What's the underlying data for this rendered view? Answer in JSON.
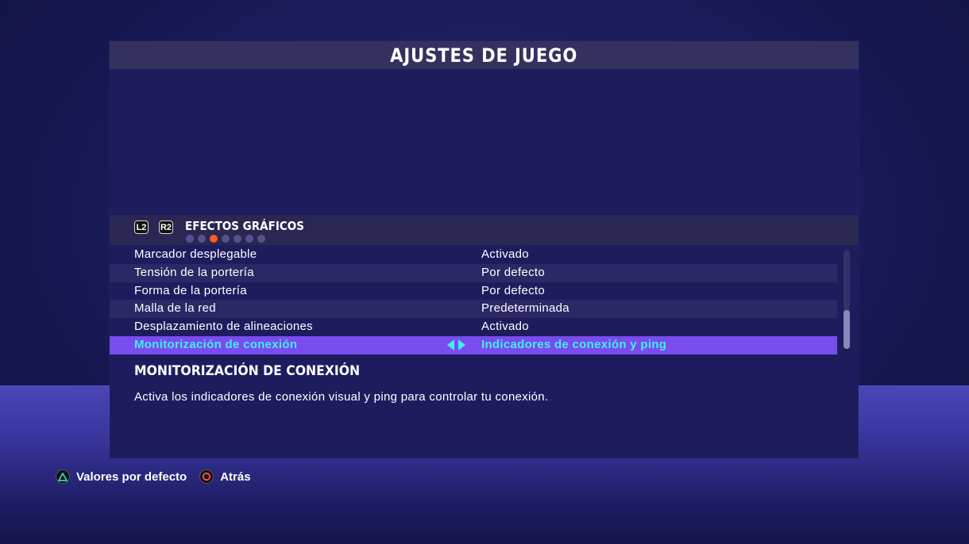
{
  "title": "AJUSTES DE JUEGO",
  "section": {
    "left_trigger": "L2",
    "right_trigger": "R2",
    "title": "EFECTOS GRÁFICOS",
    "page_count": 7,
    "active_page": 3
  },
  "settings": [
    {
      "label": "Marcador desplegable",
      "value": "Activado"
    },
    {
      "label": "Tensión de la portería",
      "value": "Por defecto"
    },
    {
      "label": "Forma de la portería",
      "value": "Por defecto"
    },
    {
      "label": "Malla de la red",
      "value": "Predeterminada"
    },
    {
      "label": "Desplazamiento de alineaciones",
      "value": "Activado"
    },
    {
      "label": "Monitorización de conexión",
      "value": "Indicadores de conexión y ping"
    }
  ],
  "selected_index": 5,
  "description": {
    "title": "MONITORIZACIÓN DE CONEXIÓN",
    "text": "Activa los indicadores de conexión visual y ping para controlar tu conexión."
  },
  "footer": {
    "defaults_label": "Valores por defecto",
    "back_label": "Atrás"
  },
  "colors": {
    "highlight": "#7a4cf0",
    "selected_text": "#3ff0f0",
    "active_dot": "#ff5a1f",
    "triangle_button": "#3fd0c0",
    "circle_button": "#ff4a5a"
  },
  "icons": {
    "defaults": "triangle-button-icon",
    "back": "circle-button-icon",
    "value_arrows": "left-right-arrows-icon"
  }
}
